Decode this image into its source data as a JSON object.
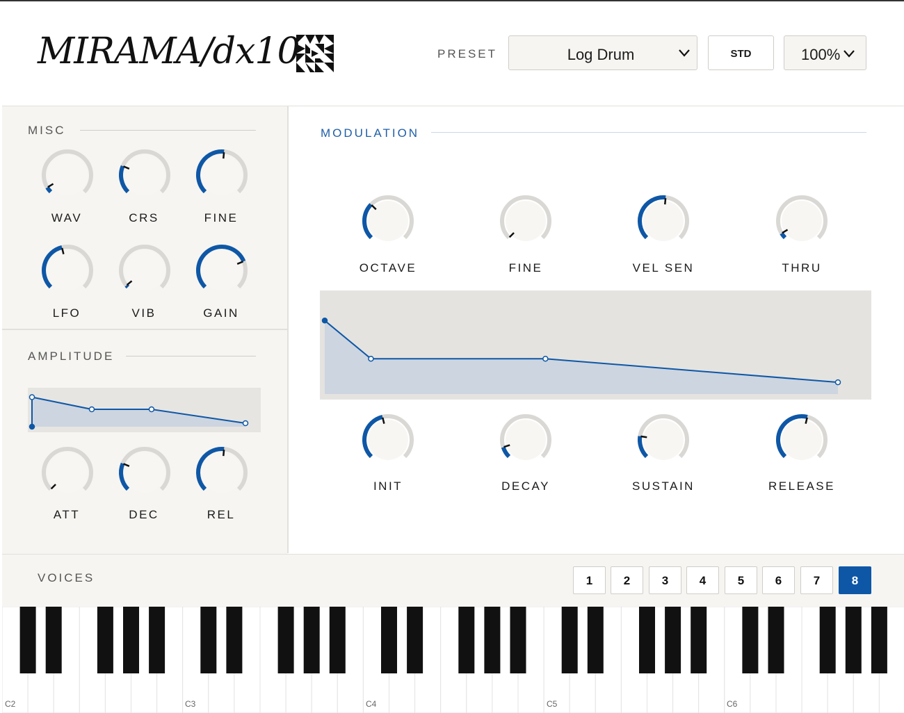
{
  "header": {
    "logo_text": "MIRAMA/dx10",
    "preset_label": "PRESET",
    "preset_value": "Log Drum",
    "std_label": "STD",
    "zoom_value": "100%"
  },
  "colors": {
    "accent": "#0e57a6",
    "track": "#d9d8d5",
    "panel": "#f6f5f2",
    "envelope_fill": "#cdd5e0"
  },
  "sections": {
    "misc": "MISC",
    "amplitude": "AMPLITUDE",
    "modulation": "MODULATION",
    "voices": "VOICES"
  },
  "knobs": {
    "misc": [
      {
        "label": "WAV",
        "value": 0.05
      },
      {
        "label": "CRS",
        "value": 0.25
      },
      {
        "label": "FINE",
        "value": 0.52
      },
      {
        "label": "LFO",
        "value": 0.45
      },
      {
        "label": "VIB",
        "value": 0.02
      },
      {
        "label": "GAIN",
        "value": 0.75
      }
    ],
    "amplitude": [
      {
        "label": "ATT",
        "value": 0.0
      },
      {
        "label": "DEC",
        "value": 0.25
      },
      {
        "label": "REL",
        "value": 0.52
      }
    ],
    "modulation_top": [
      {
        "label": "OCTAVE",
        "value": 0.33
      },
      {
        "label": "FINE",
        "value": 0.0
      },
      {
        "label": "VEL SEN",
        "value": 0.52
      },
      {
        "label": "THRU",
        "value": 0.05
      }
    ],
    "modulation_bottom": [
      {
        "label": "INIT",
        "value": 0.45
      },
      {
        "label": "DECAY",
        "value": 0.1
      },
      {
        "label": "SUSTAIN",
        "value": 0.2
      },
      {
        "label": "RELEASE",
        "value": 0.55
      }
    ]
  },
  "amp_envelope": [
    {
      "t": 0.0,
      "level": 0.0
    },
    {
      "t": 0.0,
      "level": 0.85
    },
    {
      "t": 0.28,
      "level": 0.5
    },
    {
      "t": 0.56,
      "level": 0.5
    },
    {
      "t": 1.0,
      "level": 0.1
    }
  ],
  "mod_envelope": [
    {
      "t": 0.0,
      "level": 0.75
    },
    {
      "t": 0.09,
      "level": 0.36
    },
    {
      "t": 0.43,
      "level": 0.36
    },
    {
      "t": 1.0,
      "level": 0.12
    }
  ],
  "voices": {
    "buttons": [
      "1",
      "2",
      "3",
      "4",
      "5",
      "6",
      "7",
      "8"
    ],
    "selected": "8"
  },
  "keyboard": {
    "labels": [
      "C2",
      "C3",
      "C4",
      "C5",
      "C6"
    ]
  }
}
